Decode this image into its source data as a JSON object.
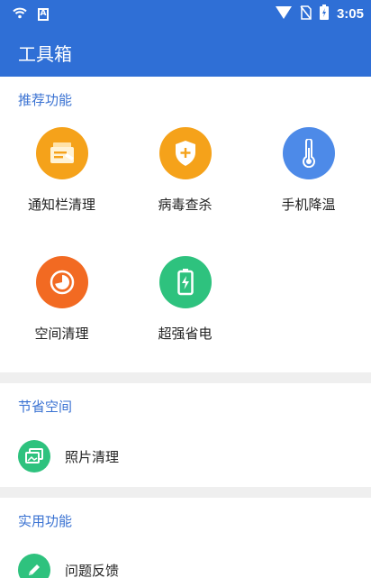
{
  "status_bar": {
    "time": "3:05",
    "notification_glyph": "A",
    "icons": [
      "wifi-icon",
      "a-notification-icon",
      "signal-icon",
      "sim-none-icon",
      "battery-charging-icon"
    ]
  },
  "app_bar": {
    "title": "工具箱"
  },
  "colors": {
    "primary": "#2f6fd6",
    "section_title": "#3a72d2",
    "orange": "#f5a21a",
    "blue": "#4d8ae8",
    "red_orange": "#f26a22",
    "green": "#2ec27e"
  },
  "sections": {
    "recommend": {
      "title": "推荐功能",
      "items": [
        {
          "label": "通知栏清理",
          "icon": "notification-clean-icon"
        },
        {
          "label": "病毒查杀",
          "icon": "shield-plus-icon"
        },
        {
          "label": "手机降温",
          "icon": "thermometer-icon"
        },
        {
          "label": "空间清理",
          "icon": "pie-chart-icon"
        },
        {
          "label": "超强省电",
          "icon": "battery-icon"
        }
      ]
    },
    "save_space": {
      "title": "节省空间",
      "items": [
        {
          "label": "照片清理",
          "icon": "photos-icon"
        }
      ]
    },
    "utilities": {
      "title": "实用功能",
      "items": [
        {
          "label": "问题反馈",
          "icon": "pencil-icon"
        }
      ]
    }
  }
}
